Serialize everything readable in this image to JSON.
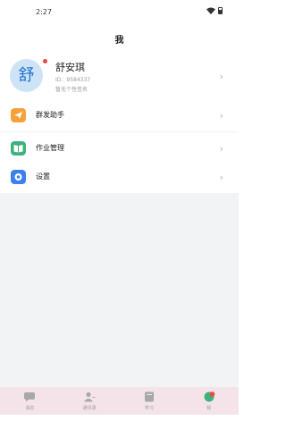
{
  "status_bar": {
    "time": "2:27"
  },
  "nav": {
    "title": "我"
  },
  "profile": {
    "avatar_char": "舒",
    "name": "舒安琪",
    "id_text": "ID：9584337",
    "signature": "暂无个性签名"
  },
  "menu_group1": [
    {
      "label": "群发助手",
      "icon": "send-icon",
      "color": "#f5a23c"
    },
    {
      "label": "作业管理",
      "icon": "book-icon",
      "color": "#3fb17d"
    }
  ],
  "menu_group2": [
    {
      "label": "设置",
      "icon": "settings-icon",
      "color": "#3c7ff1"
    }
  ],
  "tabs": [
    {
      "label": "消息",
      "icon": "chat-icon"
    },
    {
      "label": "通讯录",
      "icon": "contacts-icon"
    },
    {
      "label": "学习",
      "icon": "study-icon"
    },
    {
      "label": "我",
      "icon": "me-icon",
      "active": true
    }
  ]
}
